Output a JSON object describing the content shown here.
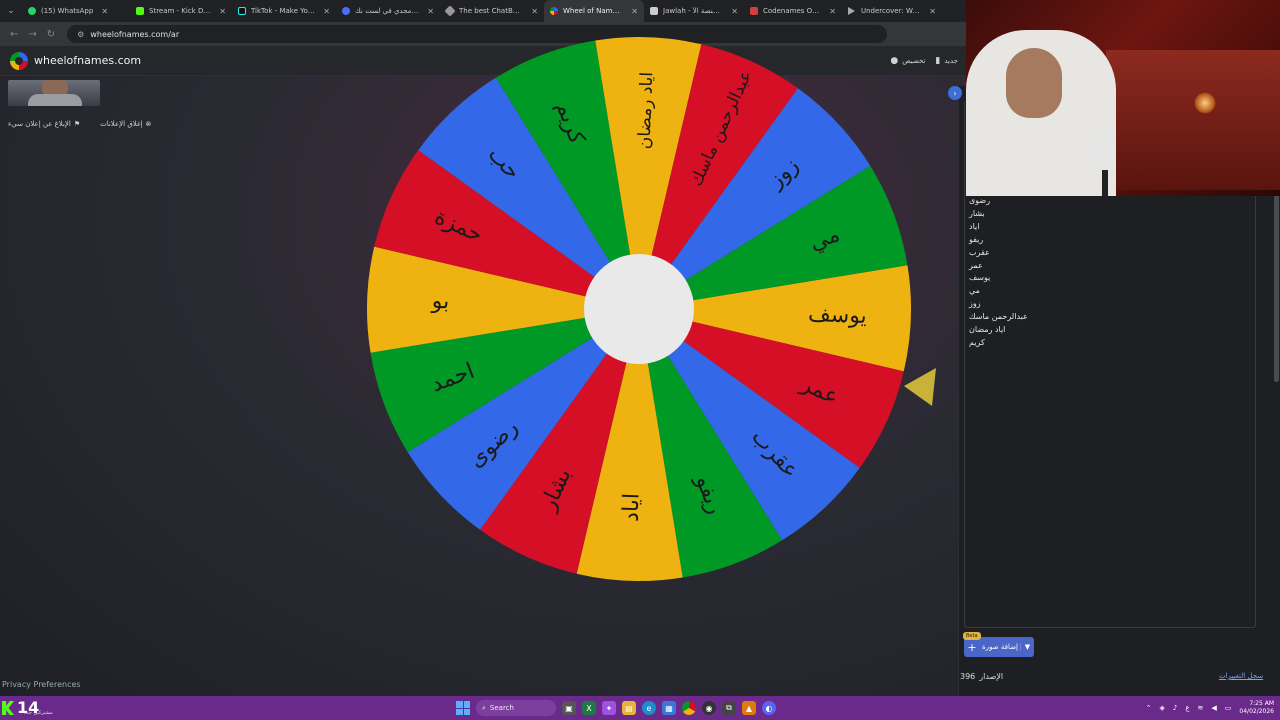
{
  "browser": {
    "tabs": [
      {
        "title": "(15) WhatsApp",
        "favicon_color": "#25d366"
      },
      {
        "title": "Stream - Kick Dashboard",
        "favicon_color": "#53fc18"
      },
      {
        "title": "TikTok - Make Your Day",
        "favicon_color": "#111111"
      },
      {
        "title": "الشيخ مجدي في لست نك",
        "favicon_color": "#4a6cf7"
      },
      {
        "title": "The best ChatBot and W",
        "favicon_color": "#999999"
      },
      {
        "title": "Wheel of Names | عجلة",
        "favicon_color": "#3369e8",
        "active": true
      },
      {
        "title": "Jawlah - جولة | منصة الأ",
        "favicon_color": "#cccccc"
      },
      {
        "title": "Codenames Online",
        "favicon_color": "#d04040"
      },
      {
        "title": "Undercover: Word Party",
        "favicon_color": "#aaaaaa"
      }
    ],
    "url": "wheelofnames.com/ar"
  },
  "site": {
    "logo_text": "wheelofnames.com",
    "customize_label": "تخصيص",
    "new_label": "جديد",
    "ad_report_label": "الإبلاغ عن إعلان سيء",
    "ad_close_label": "إغلاق الإعلانات",
    "privacy_label": "Privacy Preferences"
  },
  "wheel": {
    "segments": [
      {
        "name": "يوسف",
        "color": "#eeb211"
      },
      {
        "name": "عمر",
        "color": "#d50f25"
      },
      {
        "name": "عقرب",
        "color": "#3369e8"
      },
      {
        "name": "ريفو",
        "color": "#009925"
      },
      {
        "name": "اياد",
        "color": "#eeb211"
      },
      {
        "name": "بشار",
        "color": "#d50f25"
      },
      {
        "name": "رضوى",
        "color": "#3369e8"
      },
      {
        "name": "احمد",
        "color": "#009925"
      },
      {
        "name": "بو",
        "color": "#eeb211"
      },
      {
        "name": "حمزة",
        "color": "#d50f25"
      },
      {
        "name": "حب",
        "color": "#3369e8"
      },
      {
        "name": "كريم",
        "color": "#009925"
      },
      {
        "name": "اياد رمضان",
        "color": "#eeb211"
      },
      {
        "name": "عبدالرحمن ماسك",
        "color": "#d50f25"
      },
      {
        "name": "زوز",
        "color": "#3369e8"
      },
      {
        "name": "مي",
        "color": "#009925"
      }
    ],
    "center_color": "#e9e9e9",
    "pointer_color": "#c9b23a"
  },
  "panel": {
    "entries": [
      "رضوى",
      "بشار",
      "اياد",
      "ريفو",
      "عقرب",
      "عمر",
      "يوسف",
      "مي",
      "زوز",
      "عبدالرحمن ماسك",
      "اياد رمضان",
      "كريم"
    ],
    "add_image_label": "إضافة صورة",
    "beta_label": "Beta",
    "version_label": "الإصدار",
    "version_number": "396",
    "changelog_label": "سجل التغييرات"
  },
  "taskbar": {
    "counter": "14",
    "counter_sub": "مشتركين جدد",
    "search_label": "Search",
    "time": "7:25 AM",
    "date": "04/02/2026"
  }
}
